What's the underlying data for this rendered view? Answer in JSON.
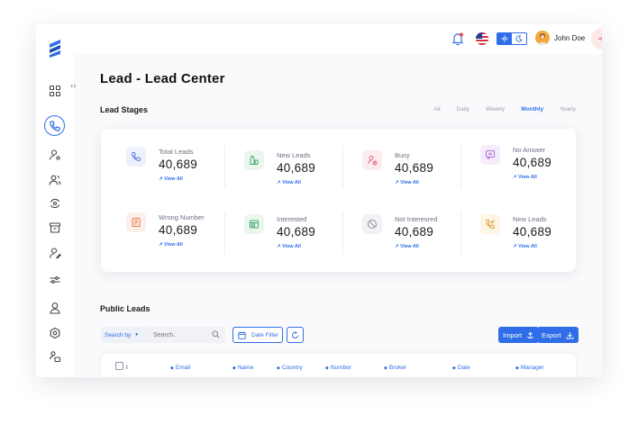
{
  "header": {
    "page_title": "Lead - Lead Center",
    "user_name": "John Doe"
  },
  "lead_stages": {
    "title": "Lead Stages",
    "periods": [
      "All",
      "Daily",
      "Weekly",
      "Monthly",
      "Yearly"
    ],
    "active_period": "Monthly",
    "stats": [
      {
        "label": "Total Leads",
        "value": "40,689",
        "link": "View All",
        "icon": "phone-icon",
        "color": "#5b7ce8",
        "bg": "#eef1fd"
      },
      {
        "label": "New Leads",
        "value": "40,689",
        "link": "View All",
        "icon": "bottles-icon",
        "color": "#3ea86a",
        "bg": "#e9f7ef"
      },
      {
        "label": "Busy",
        "value": "40,689",
        "link": "View All",
        "icon": "busy-icon",
        "color": "#e8637a",
        "bg": "#fdecef"
      },
      {
        "label": "No Answer",
        "value": "40,689",
        "link": "View All",
        "icon": "no-answer-icon",
        "color": "#b46ad9",
        "bg": "#f5edfb"
      },
      {
        "label": "Wrong Number",
        "value": "40,689",
        "link": "View All",
        "icon": "wrong-number-icon",
        "color": "#e8764a",
        "bg": "#fdefe9"
      },
      {
        "label": "Interested",
        "value": "40,689",
        "link": "View All",
        "icon": "interested-icon",
        "color": "#3ea86a",
        "bg": "#e9f7ef"
      },
      {
        "label": "Not Interesred",
        "value": "40,689",
        "link": "View All",
        "icon": "not-interested-icon",
        "color": "#8a8f99",
        "bg": "#f1f2f4"
      },
      {
        "label": "New Leads",
        "value": "40,689",
        "link": "View All",
        "icon": "incoming-call-icon",
        "color": "#e0a23a",
        "bg": "#fdf5e6"
      }
    ]
  },
  "public_leads": {
    "title": "Public Leads",
    "search_by_label": "Search by",
    "search_placeholder": "Search..",
    "date_filter_label": "Date Filter",
    "import_label": "Import",
    "export_label": "Export",
    "columns": [
      "I",
      "Email",
      "Name",
      "Country",
      "Number",
      "Broker",
      "Date",
      "Manager"
    ]
  },
  "colors": {
    "accent": "#2f6ee8"
  }
}
